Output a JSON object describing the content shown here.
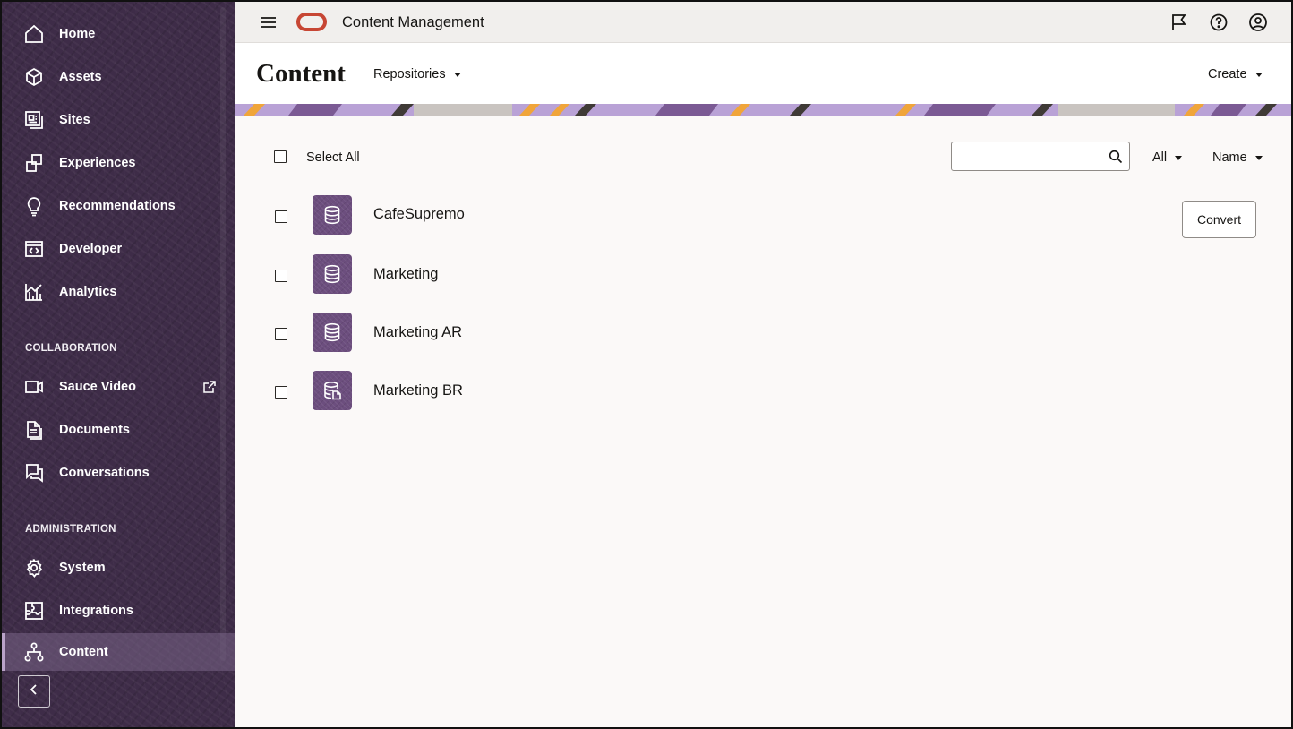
{
  "app": {
    "title": "Content Management"
  },
  "sidebar": {
    "items": [
      {
        "label": "Home",
        "icon": "home-icon"
      },
      {
        "label": "Assets",
        "icon": "cube-icon"
      },
      {
        "label": "Sites",
        "icon": "sites-icon"
      },
      {
        "label": "Experiences",
        "icon": "experiences-icon"
      },
      {
        "label": "Recommendations",
        "icon": "lightbulb-icon"
      },
      {
        "label": "Developer",
        "icon": "code-icon"
      },
      {
        "label": "Analytics",
        "icon": "analytics-icon"
      }
    ],
    "collaboration_heading": "COLLABORATION",
    "collaboration_items": [
      {
        "label": "Sauce Video",
        "icon": "video-icon",
        "external": true
      },
      {
        "label": "Documents",
        "icon": "documents-icon"
      },
      {
        "label": "Conversations",
        "icon": "conversations-icon"
      }
    ],
    "administration_heading": "ADMINISTRATION",
    "administration_items": [
      {
        "label": "System",
        "icon": "gear-icon"
      },
      {
        "label": "Integrations",
        "icon": "puzzle-icon"
      },
      {
        "label": "Content",
        "icon": "hierarchy-icon",
        "active": true
      }
    ]
  },
  "page": {
    "title": "Content",
    "repositories_label": "Repositories",
    "create_label": "Create"
  },
  "toolbar": {
    "select_all_label": "Select All",
    "search_placeholder": "",
    "filter_label": "All",
    "sort_label": "Name"
  },
  "repositories": [
    {
      "name": "CafeSupremo",
      "icon": "repository-icon",
      "action": "Convert"
    },
    {
      "name": "Marketing",
      "icon": "repository-icon"
    },
    {
      "name": "Marketing AR",
      "icon": "repository-icon"
    },
    {
      "name": "Marketing BR",
      "icon": "business-repository-icon"
    }
  ],
  "colors": {
    "sidebar_bg": "#3e2c48",
    "repo_tile": "#6c4e7e",
    "oracle_red": "#c74634",
    "banner_orange": "#f0a53a",
    "banner_lavender": "#b9a2d6"
  }
}
